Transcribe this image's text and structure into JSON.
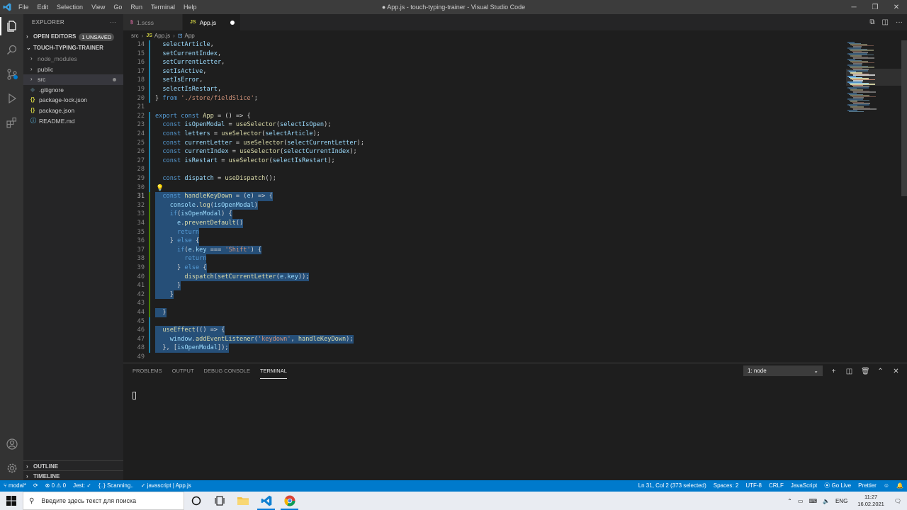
{
  "window": {
    "title": "● App.js - touch-typing-trainer - Visual Studio Code",
    "menu": [
      "File",
      "Edit",
      "Selection",
      "View",
      "Go",
      "Run",
      "Terminal",
      "Help"
    ]
  },
  "sidebar": {
    "title": "EXPLORER",
    "open_editors": "OPEN EDITORS",
    "unsaved_badge": "1 UNSAVED",
    "project": "TOUCH-TYPING-TRAINER",
    "items": [
      {
        "label": "node_modules",
        "type": "folder"
      },
      {
        "label": "public",
        "type": "folder"
      },
      {
        "label": "src",
        "type": "folder"
      },
      {
        "label": ".gitignore",
        "type": "file"
      },
      {
        "label": "package-lock.json",
        "type": "json"
      },
      {
        "label": "package.json",
        "type": "json"
      },
      {
        "label": "README.md",
        "type": "md"
      }
    ],
    "outline": "OUTLINE",
    "timeline": "TIMELINE"
  },
  "tabs": [
    {
      "label": "1.scss",
      "icon": "scss-icon"
    },
    {
      "label": "App.js",
      "icon": "js-icon",
      "js_label": "JS"
    }
  ],
  "breadcrumb": {
    "folder": "src",
    "file": "App.js",
    "symbol": "App",
    "js_label": "JS"
  },
  "editor": {
    "lines": [
      {
        "n": "14",
        "code": "  selectArticle,"
      },
      {
        "n": "15",
        "code": "  setCurrentIndex,"
      },
      {
        "n": "16",
        "code": "  setCurrentLetter,"
      },
      {
        "n": "17",
        "code": "  setIsActive,"
      },
      {
        "n": "18",
        "code": "  setIsError,"
      },
      {
        "n": "19",
        "code": "  selectIsRestart,"
      },
      {
        "n": "20",
        "code": "} from './store/fieldSlice';"
      },
      {
        "n": "21",
        "code": ""
      },
      {
        "n": "22",
        "code": "export const App = () => {"
      },
      {
        "n": "23",
        "code": "  const isOpenModal = useSelector(selectIsOpen);"
      },
      {
        "n": "24",
        "code": "  const letters = useSelector(selectArticle);"
      },
      {
        "n": "25",
        "code": "  const currentLetter = useSelector(selectCurrentLetter);"
      },
      {
        "n": "26",
        "code": "  const currentIndex = useSelector(selectCurrentIndex);"
      },
      {
        "n": "27",
        "code": "  const isRestart = useSelector(selectIsRestart);"
      },
      {
        "n": "28",
        "code": ""
      },
      {
        "n": "29",
        "code": "  const dispatch = useDispatch();"
      },
      {
        "n": "30",
        "code": ""
      },
      {
        "n": "31",
        "code": "  const handleKeyDown = (e) => {"
      },
      {
        "n": "32",
        "code": "    console.log(isOpenModal)"
      },
      {
        "n": "33",
        "code": "    if(isOpenModal) {"
      },
      {
        "n": "34",
        "code": "      e.preventDefault()"
      },
      {
        "n": "35",
        "code": "      return"
      },
      {
        "n": "36",
        "code": "    } else {"
      },
      {
        "n": "37",
        "code": "      if(e.key === 'Shift') {"
      },
      {
        "n": "38",
        "code": "        return"
      },
      {
        "n": "39",
        "code": "      } else {"
      },
      {
        "n": "40",
        "code": "        dispatch(setCurrentLetter(e.key));"
      },
      {
        "n": "41",
        "code": "      }"
      },
      {
        "n": "42",
        "code": "    }"
      },
      {
        "n": "43",
        "code": ""
      },
      {
        "n": "44",
        "code": "  }"
      },
      {
        "n": "45",
        "code": ""
      },
      {
        "n": "46",
        "code": "  useEffect(() => {"
      },
      {
        "n": "47",
        "code": "    window.addEventListener('keydown', handleKeyDown);"
      },
      {
        "n": "48",
        "code": "  }, [isOpenModal]);"
      },
      {
        "n": "49",
        "code": ""
      }
    ]
  },
  "panel": {
    "tabs": [
      "PROBLEMS",
      "OUTPUT",
      "DEBUG CONSOLE",
      "TERMINAL"
    ],
    "terminal_select": "1: node"
  },
  "statusbar": {
    "branch": "modal*",
    "errors": "0",
    "warnings": "0",
    "jest": "Jest: ✓",
    "scanning": "{..} Scanning..",
    "filter": "javascript | App.js",
    "position": "Ln 31, Col 2 (373 selected)",
    "spaces": "Spaces: 2",
    "encoding": "UTF-8",
    "eol": "CRLF",
    "language": "JavaScript",
    "golive": "Go Live",
    "prettier": "Prettier"
  },
  "taskbar": {
    "search_placeholder": "Введите здесь текст для поиска",
    "lang": "ENG",
    "time": "11:27",
    "date": "16.02.2021"
  },
  "colors": {
    "accent": "#007acc",
    "selection": "#264f78",
    "keyword": "#569cd6",
    "function": "#dcdcaa",
    "variable": "#9cdcfe",
    "string": "#ce9178"
  }
}
